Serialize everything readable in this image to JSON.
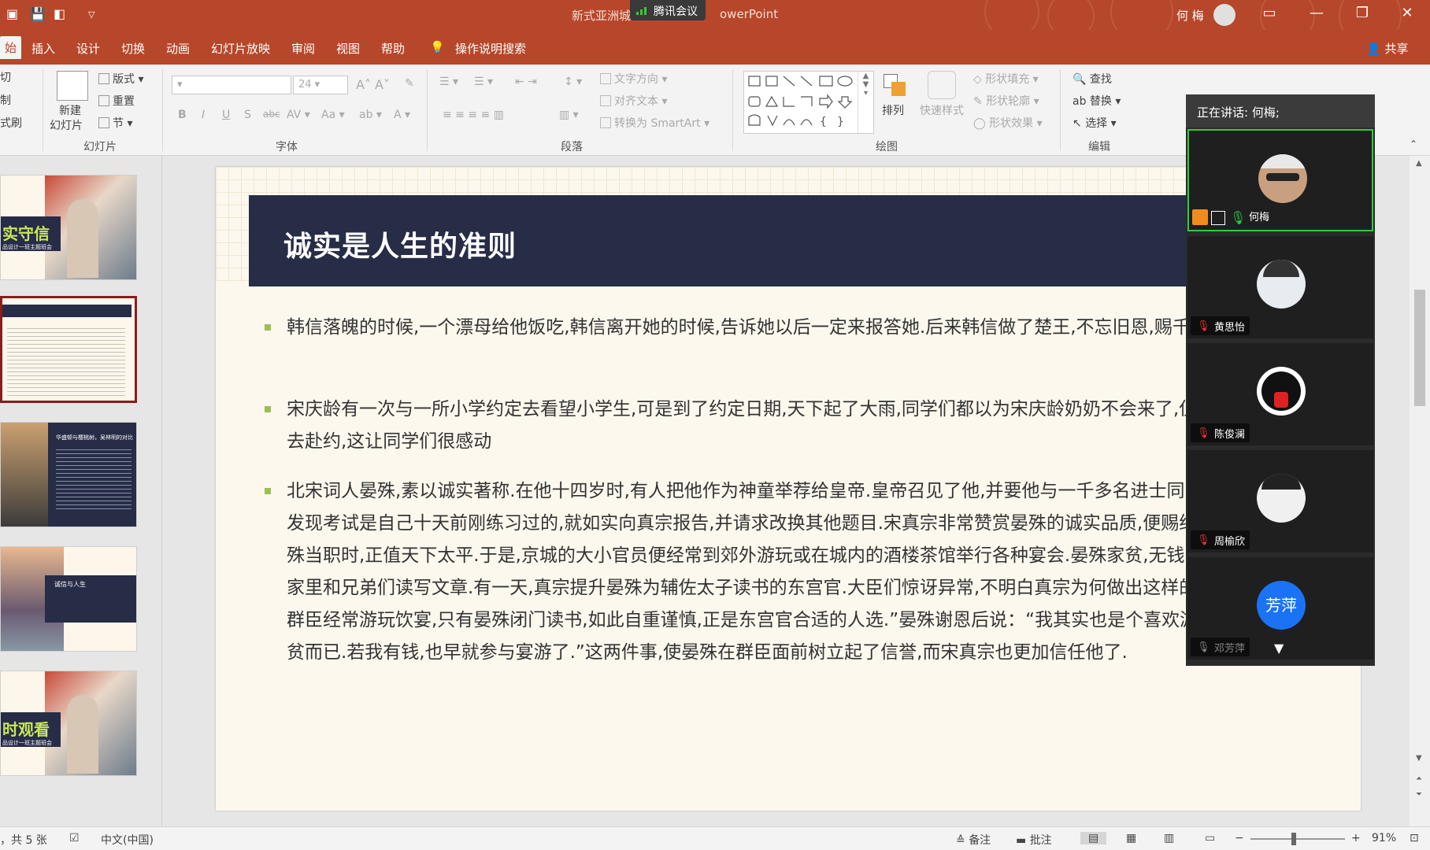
{
  "titlebar": {
    "doc_title": "新式亚洲城",
    "doc_title_suffix": "owerPoint",
    "meeting_app": "腾讯会议",
    "user_name": "何 梅"
  },
  "tabs": [
    "始",
    "插入",
    "设计",
    "切换",
    "动画",
    "幻灯片放映",
    "审阅",
    "视图",
    "帮助",
    "操作说明搜索"
  ],
  "share_label": "共享",
  "ribbon": {
    "clipboard": {
      "cut": "切",
      "copy": "制",
      "format": "式刷"
    },
    "slides": {
      "new_slide": "新建",
      "new_slide2": "幻灯片",
      "layout": "版式",
      "reset": "重置",
      "section": "节",
      "group": "幻灯片"
    },
    "font": {
      "size": "24",
      "group": "字体"
    },
    "paragraph": {
      "text_direction": "文字方向",
      "align_text": "对齐文本",
      "smartart": "转换为 SmartArt",
      "group": "段落"
    },
    "drawing": {
      "arrange": "排列",
      "quick_styles": "快速样式",
      "fill": "形状填充",
      "outline": "形状轮廓",
      "effects": "形状效果",
      "group": "绘图"
    },
    "editing": {
      "find": "查找",
      "replace": "替换",
      "select": "选择",
      "group": "编辑"
    }
  },
  "thumbs": {
    "t1_title": "实守信",
    "t1_sub": "品设计一班主题班会",
    "t3_title": "华盛顿与樱桃树，吴林明的对比",
    "t4_title": "诚信与人生",
    "t5_title": "时观看",
    "t5_sub": "品设计一班主题班会"
  },
  "slide": {
    "title": "诚实是人生的准则",
    "bullets": [
      "韩信落魄的时候,一个漂母给他饭吃,韩信离开她的时候,告诉她以后一定来报答她.后来韩信做了楚王,不忘旧恩,赐千金千两以漂母",
      "宋庆龄有一次与一所小学约定去看望小学生,可是到了约定日期,天下起了大雨,同学们都以为宋庆龄奶奶不会来了,但宋庆龄依然冒雨前去赴约,这让同学们很感动",
      "北宋词人晏殊,素以诚实著称.在他十四岁时,有人把他作为神童举荐给皇帝.皇帝召见了他,并要他与一千多名进士同时参加考试.结果晏殊发现考试是自己十天前刚练习过的,就如实向真宗报告,并请求改换其他题目.宋真宗非常赞赏晏殊的诚实品质,便赐给他“同进士出身”.晏殊当职时,正值天下太平.于是,京城的大小官员便经常到郊外游玩或在城内的酒楼茶馆举行各种宴会.晏殊家贫,无钱出去吃喝玩乐,只好在家里和兄弟们读写文章.有一天,真宗提升晏殊为辅佐太子读书的东宫官.大臣们惊讶异常,不明白真宗为何做出这样的决定.真宗说：“近来群臣经常游玩饮宴,只有晏殊闭门读书,如此自重谨慎,正是东宫官合适的人选.”晏殊谢恩后说：“我其实也是个喜欢游玩饮宴的人,只是家贫而已.若我有钱,也早就参与宴游了.”这两件事,使晏殊在群臣面前树立起了信誉,而宋真宗也更加信任他了."
    ]
  },
  "status": {
    "slide_count": "，共 5 张",
    "language": "中文(中国)",
    "notes": "备注",
    "comments": "批注",
    "zoom": "91%"
  },
  "meeting": {
    "speaking": "正在讲话: 何梅;",
    "participants": [
      {
        "name": "何梅"
      },
      {
        "name": "黄思怡"
      },
      {
        "name": "陈俊澜"
      },
      {
        "name": "周榆欣"
      },
      {
        "name": "邓芳萍",
        "avatar_text": "芳萍"
      }
    ]
  },
  "colors": {
    "accent": "#b7472a",
    "banner": "#272c47",
    "bullet": "#9bbf52",
    "active_speaker": "#2ecc40",
    "avatar_blue": "#1a73f5"
  }
}
